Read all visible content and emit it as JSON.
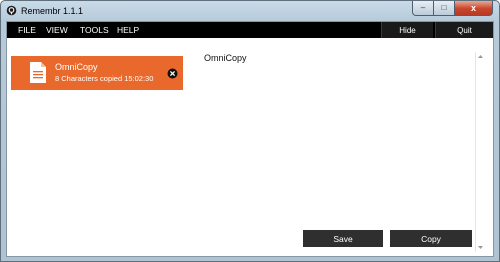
{
  "window": {
    "title": "Remembr 1.1.1",
    "controls": {
      "minimize": "–",
      "maximize": "□",
      "close": "x"
    }
  },
  "menu": {
    "items": [
      "FILE",
      "VIEW",
      "TOOLS",
      "HELP"
    ],
    "hide_label": "Hide",
    "quit_label": "Quit"
  },
  "clipboard_items": [
    {
      "title": "OmniCopy",
      "subtitle": "8 Characters copied 15:02:30",
      "icon": "document-icon",
      "color": "#e9692c"
    }
  ],
  "detail": {
    "title": "OmniCopy"
  },
  "actions": {
    "save_label": "Save",
    "copy_label": "Copy"
  },
  "colors": {
    "menubar": "#000000",
    "accent": "#e9692c",
    "button": "#2f2f2f"
  }
}
